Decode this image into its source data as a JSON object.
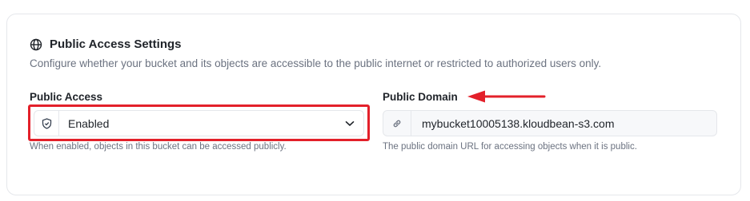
{
  "section": {
    "title": "Public Access Settings",
    "description": "Configure whether your bucket and its objects are accessible to the public internet or restricted to authorized users only."
  },
  "public_access": {
    "label": "Public Access",
    "value": "Enabled",
    "help": "When enabled, objects in this bucket can be accessed publicly."
  },
  "public_domain": {
    "label": "Public Domain",
    "value": "mybucket10005138.kloudbean-s3.com",
    "help": "The public domain URL for accessing objects when it is public."
  },
  "icons": {
    "section": "globe-icon",
    "access": "shield-icon",
    "dropdown": "chevron-down-icon",
    "domain": "link-icon",
    "annotation": "arrow-left-icon"
  },
  "colors": {
    "annotation": "#e3202a",
    "border": "#e5e7eb",
    "muted_text": "#6b7280"
  }
}
